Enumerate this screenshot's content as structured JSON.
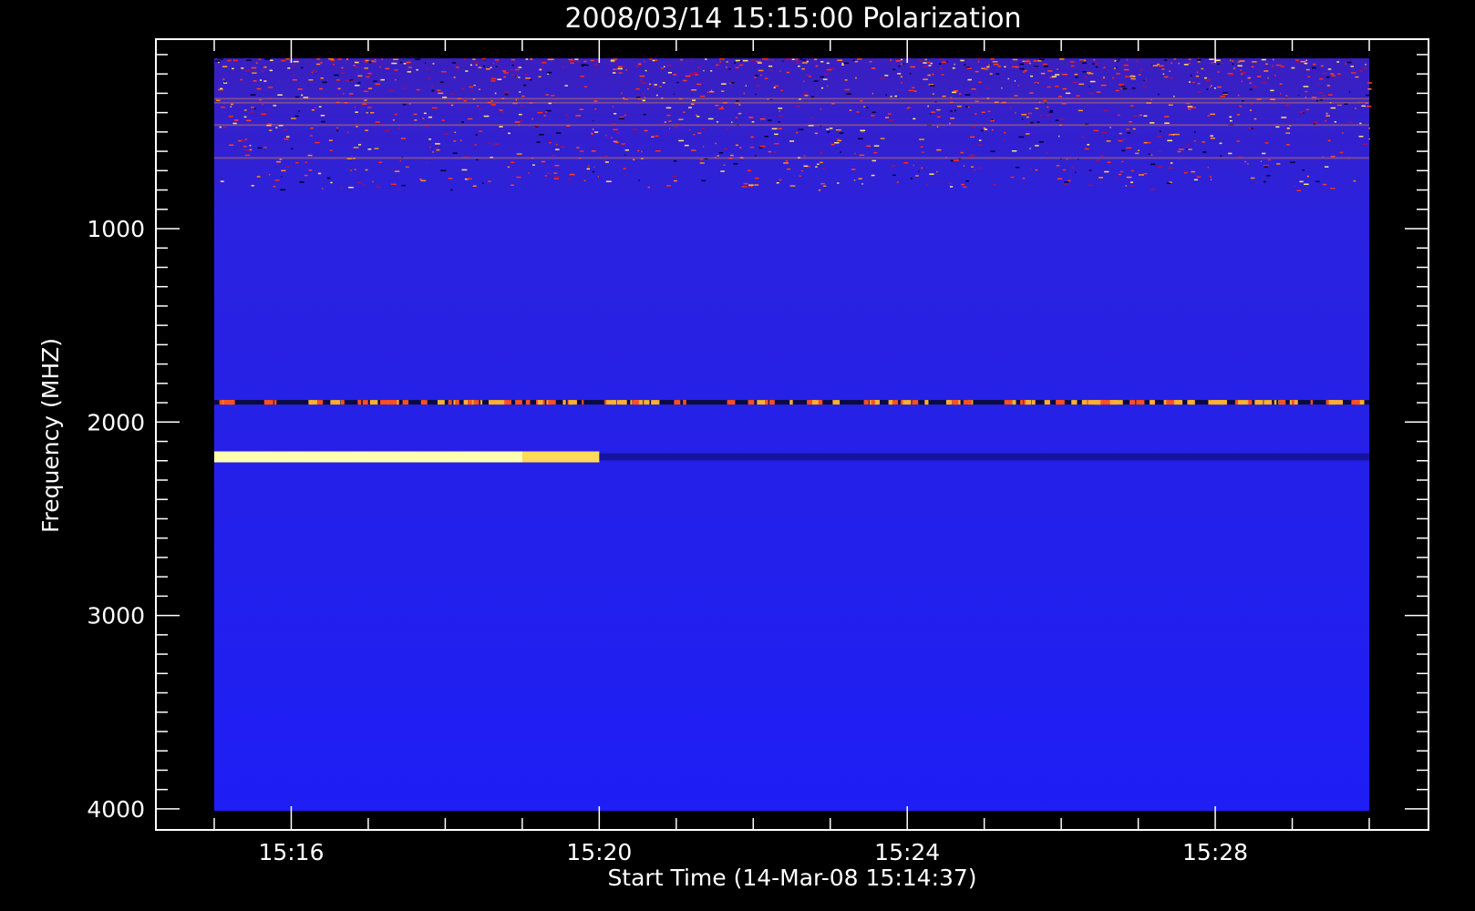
{
  "chart_data": {
    "type": "heatmap",
    "title": "2008/03/14 15:15:00 Polarization",
    "xlabel": "Start Time (14-Mar-08 15:14:37)",
    "ylabel": "Frequency (MHZ)",
    "x_range": [
      "15:15:00",
      "15:30:00"
    ],
    "y_range": [
      100,
      4000
    ],
    "y_reversed": true,
    "x_ticks": [
      {
        "label": "15:16",
        "minute": 16
      },
      {
        "label": "15:20",
        "minute": 20
      },
      {
        "label": "15:24",
        "minute": 24
      },
      {
        "label": "15:28",
        "minute": 28
      }
    ],
    "y_ticks": [
      {
        "label": "1000",
        "value": 1000
      },
      {
        "label": "2000",
        "value": 2000
      },
      {
        "label": "3000",
        "value": 3000
      },
      {
        "label": "4000",
        "value": 4000
      }
    ],
    "background_color": "#1e1ef5",
    "features": [
      {
        "name": "noisy band",
        "freq_range": [
          100,
          800
        ],
        "time_range": [
          "15:15",
          "15:30"
        ]
      },
      {
        "name": "interference line",
        "freq": 1900,
        "time_range": [
          "15:15",
          "15:30"
        ]
      },
      {
        "name": "strong polarized emission",
        "freq": 2180,
        "time_range": [
          "15:15",
          "15:20"
        ],
        "color": "#ffffb0"
      }
    ]
  }
}
